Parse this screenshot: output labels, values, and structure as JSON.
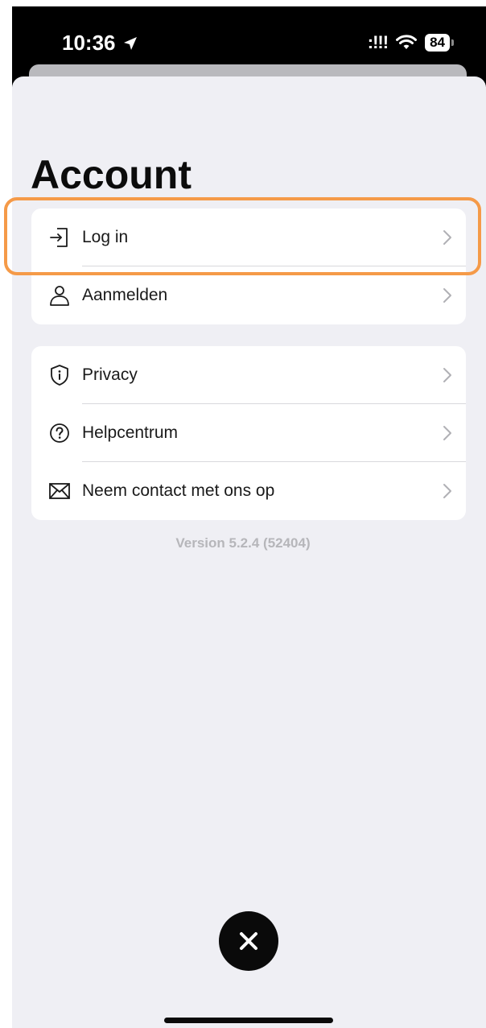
{
  "status_bar": {
    "time": "10:36",
    "signal": ":!!!",
    "battery": "84"
  },
  "page": {
    "title": "Account"
  },
  "account_list": [
    {
      "label": "Log in",
      "icon": "login-icon",
      "highlighted": true
    },
    {
      "label": "Aanmelden",
      "icon": "person-icon"
    }
  ],
  "info_list": [
    {
      "label": "Privacy",
      "icon": "shield-info-icon"
    },
    {
      "label": "Helpcentrum",
      "icon": "question-circle-icon"
    },
    {
      "label": "Neem contact met ons op",
      "icon": "envelope-icon"
    }
  ],
  "footer": {
    "version": "Version 5.2.4 (52404)"
  },
  "colors": {
    "sheet_bg": "#efeff4",
    "highlight": "#f59a48",
    "chevron": "#b0b0b5"
  }
}
